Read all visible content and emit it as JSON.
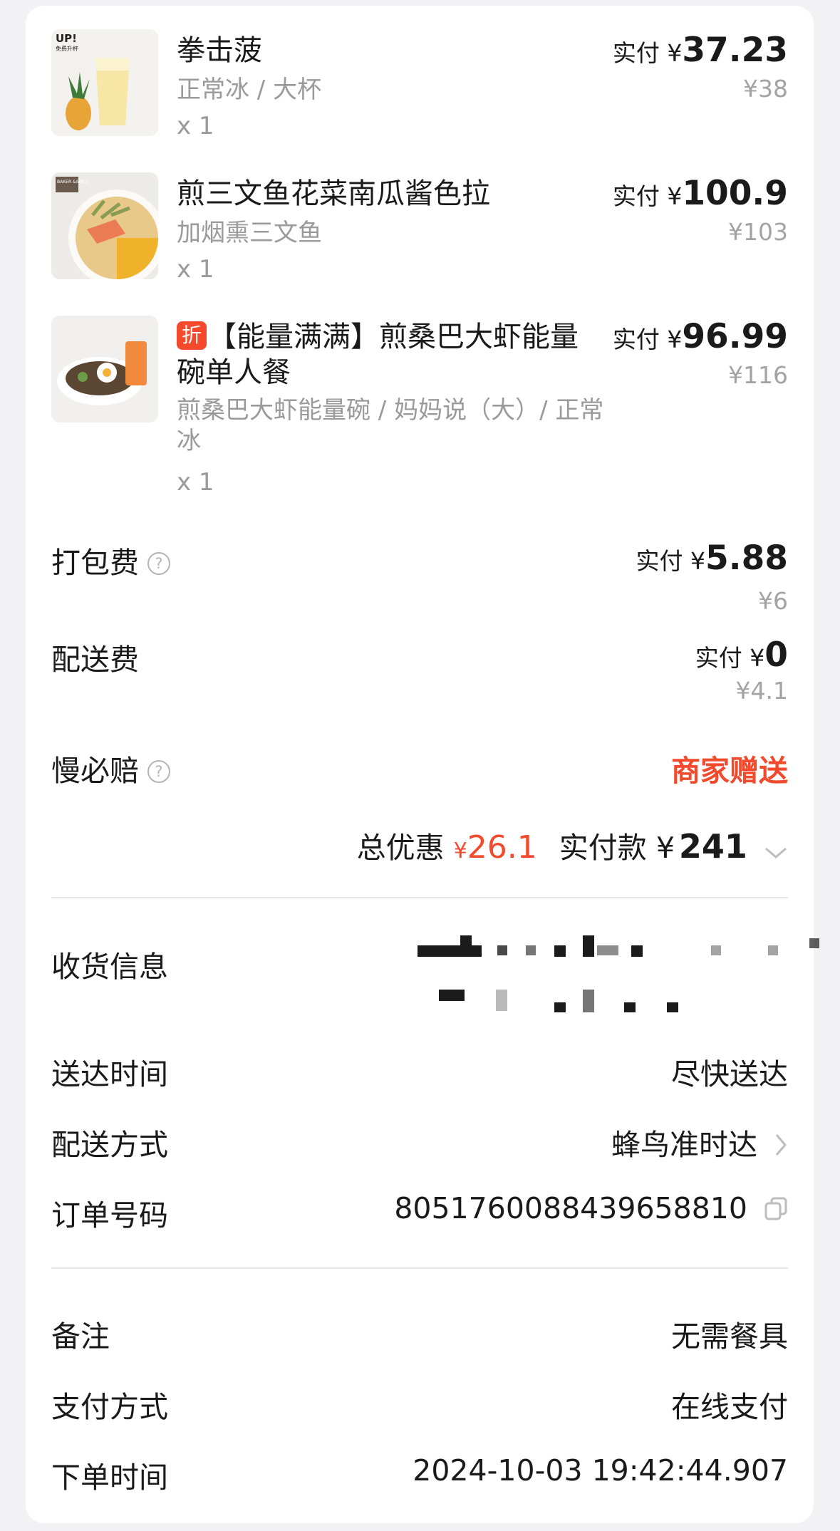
{
  "products": [
    {
      "name": "拳击菠",
      "tag": "",
      "spec": "正常冰 / 大杯",
      "qty": "x 1",
      "pay_label": "实付 ¥",
      "pay": "37.23",
      "orig": "¥38",
      "thumb_badge": "UP!",
      "thumb_badge_sub": "免费升杯"
    },
    {
      "name": "煎三文鱼花菜南瓜酱色拉",
      "tag": "",
      "spec": "加烟熏三文鱼",
      "qty": "x 1",
      "pay_label": "实付 ¥",
      "pay": "100.9",
      "orig": "¥103",
      "thumb_badge": "BAKER &SPICE"
    },
    {
      "name": "【能量满满】煎桑巴大虾能量碗单人餐",
      "tag": "折",
      "spec": "煎桑巴大虾能量碗 / 妈妈说（大）/ 正常冰",
      "qty": "x 1",
      "pay_label": "实付 ¥",
      "pay": "96.99",
      "orig": "¥116"
    }
  ],
  "fees": {
    "packing": {
      "label": "打包费",
      "pay_label": "实付 ¥",
      "pay": "5.88",
      "orig": "¥6",
      "help_icon": "question-circle-icon"
    },
    "delivery": {
      "label": "配送费",
      "pay_label": "实付 ¥",
      "pay": "0",
      "orig": "¥4.1"
    },
    "late": {
      "label": "慢必赔",
      "value": "商家赠送",
      "help_icon": "question-circle-icon"
    }
  },
  "summary": {
    "discount_label": "总优惠",
    "discount_currency": "¥",
    "discount": "26.1",
    "total_label": "实付款 ¥",
    "total": "241"
  },
  "info": {
    "address_label": "收货信息",
    "time_label": "送达时间",
    "time_value": "尽快送达",
    "method_label": "配送方式",
    "method_value": "蜂鸟准时达",
    "order_label": "订单号码",
    "order_value": "8051760088439658810"
  },
  "extra": {
    "note_label": "备注",
    "note_value": "无需餐具",
    "pay_label": "支付方式",
    "pay_value": "在线支付",
    "ordered_label": "下单时间",
    "ordered_value": "2024-10-03 19:42:44.907"
  },
  "colors": {
    "accent_red": "#f24a2c",
    "tag_red": "#f5492c",
    "muted": "#9a9a9a"
  }
}
